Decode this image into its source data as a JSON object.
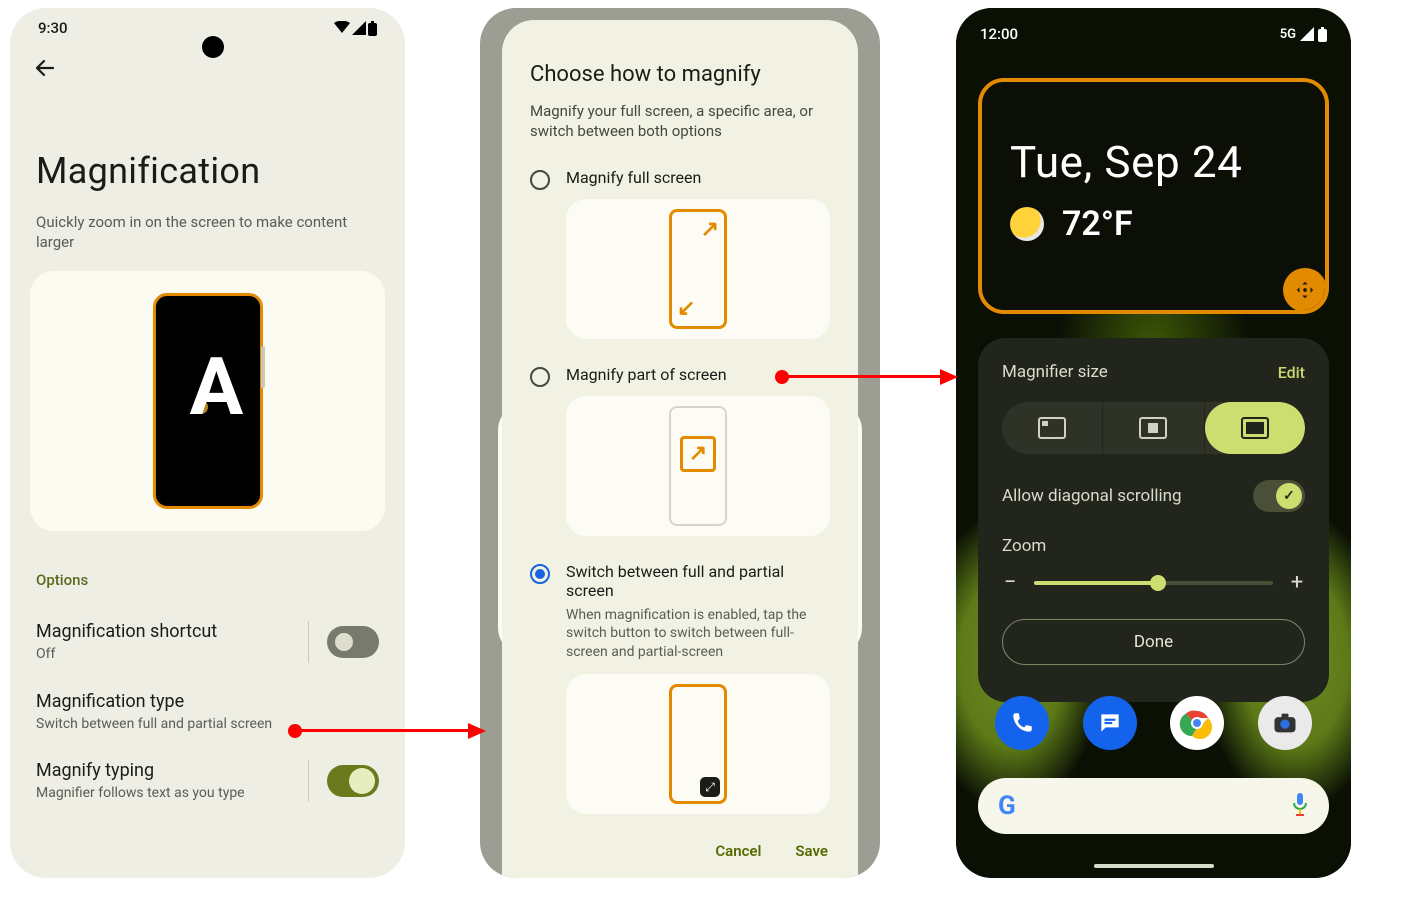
{
  "screen1": {
    "status_time": "9:30",
    "title": "Magnification",
    "subtitle": "Quickly zoom in on the screen to make content larger",
    "section_label": "Options",
    "shortcut": {
      "title": "Magnification shortcut",
      "sub": "Off",
      "enabled": false
    },
    "type": {
      "title": "Magnification type",
      "sub": "Switch between full and partial screen"
    },
    "typing": {
      "title": "Magnify typing",
      "sub": "Magnifier follows text as you type",
      "enabled": true
    }
  },
  "screen2": {
    "title": "Choose how to magnify",
    "subtitle": "Magnify your full screen, a specific area, or switch between both options",
    "opt_full": {
      "label": "Magnify full screen"
    },
    "opt_part": {
      "label": "Magnify part of screen"
    },
    "opt_switch": {
      "label": "Switch between full and partial screen",
      "sub": "When magnification is enabled, tap the switch button to switch between full-screen and partial-screen"
    },
    "cancel": "Cancel",
    "save": "Save"
  },
  "screen3": {
    "status_time": "12:00",
    "status_net": "5G",
    "date": "Tue, Sep 24",
    "temperature": "72°F",
    "panel": {
      "size_label": "Magnifier size",
      "edit": "Edit",
      "diag_label": "Allow diagonal scrolling",
      "diag_on": true,
      "zoom_label": "Zoom",
      "done": "Done"
    }
  }
}
